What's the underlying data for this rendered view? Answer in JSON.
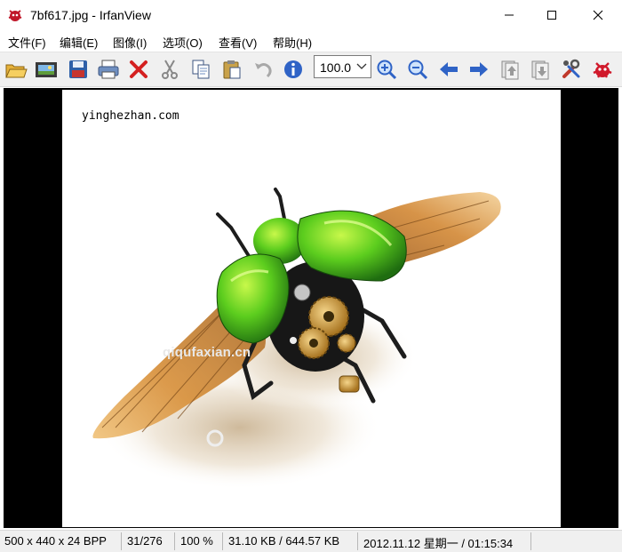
{
  "window": {
    "title": "7bf617.jpg - IrfanView"
  },
  "menu": [
    "文件(F)",
    "编辑(E)",
    "图像(I)",
    "选项(O)",
    "查看(V)",
    "帮助(H)"
  ],
  "toolbar": {
    "zoom_value": "100.0",
    "buttons": [
      "open-icon",
      "thumbnails-icon",
      "save-icon",
      "print-icon",
      "delete-icon",
      "cut-icon",
      "copy-icon",
      "paste-icon",
      "undo-icon",
      "info-icon",
      "zoom-in-icon",
      "zoom-out-icon",
      "previous-icon",
      "next-icon",
      "page-up-icon",
      "page-down-icon",
      "settings-icon",
      "irfanview-logo-icon"
    ]
  },
  "image": {
    "watermark_top": "yinghezhan.com",
    "watermark_bottom": "qiqufaxian.cn"
  },
  "status": {
    "dimensions": "500 x 440 x 24 BPP",
    "index": "31/276",
    "zoom": "100 %",
    "size": "31.10 KB / 644.57 KB",
    "datetime": "2012.11.12 星期一 / 01:15:34"
  }
}
